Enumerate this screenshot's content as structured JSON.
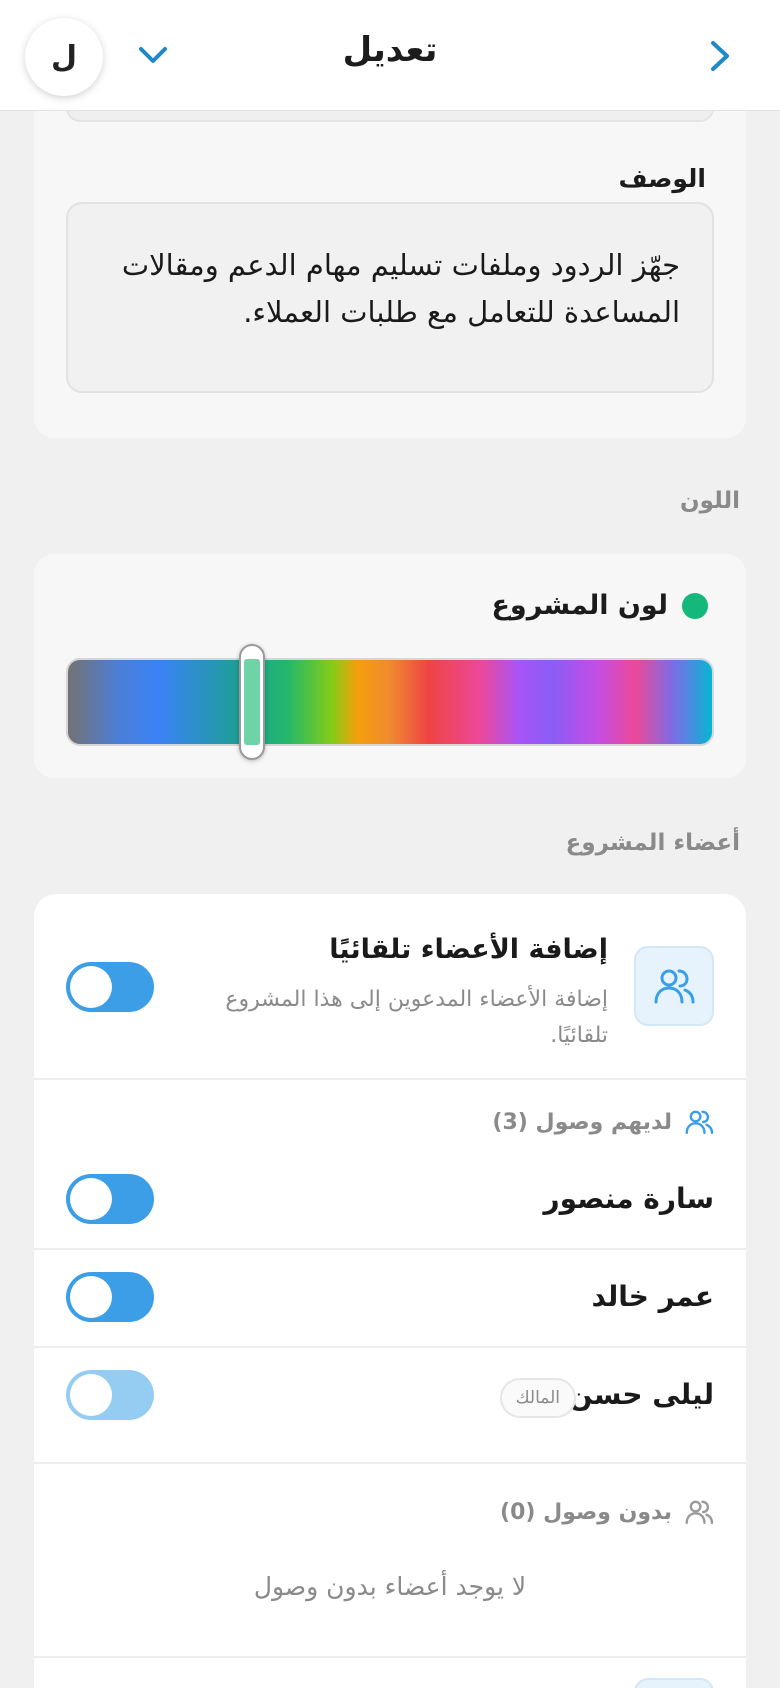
{
  "header": {
    "title": "تعديل",
    "avatar_letter": "ل",
    "back_icon": "chevron-right-icon",
    "menu_icon": "chevron-down-icon"
  },
  "description": {
    "label": "الوصف",
    "value": "جهّز الردود وملفات تسليم مهام الدعم ومقالات المساعدة للتعامل مع طلبات العملاء."
  },
  "color": {
    "section_title": "اللون",
    "label": "لون المشروع",
    "selected_color": "#14b87a",
    "slider_position_fraction": 0.29
  },
  "members": {
    "section_title": "أعضاء المشروع",
    "auto_add": {
      "title": "إضافة الأعضاء تلقائيًا",
      "subtitle": "إضافة الأعضاء المدعوين إلى هذا المشروع تلقائيًا.",
      "enabled": false,
      "icon": "users-icon"
    },
    "with_access": {
      "heading": "لديهم وصول (3)",
      "items": [
        {
          "name": "سارة منصور",
          "access": false
        },
        {
          "name": "عمر خالد",
          "access": false
        },
        {
          "name": "ليلى حسن",
          "badge": "المالك",
          "access": false,
          "disabled": true
        }
      ]
    },
    "without_access": {
      "heading": "بدون وصول (0)",
      "empty_text": "لا يوجد أعضاء بدون وصول"
    }
  },
  "colors": {
    "accent": "#3b9ee6",
    "link": "#1e88c8"
  }
}
